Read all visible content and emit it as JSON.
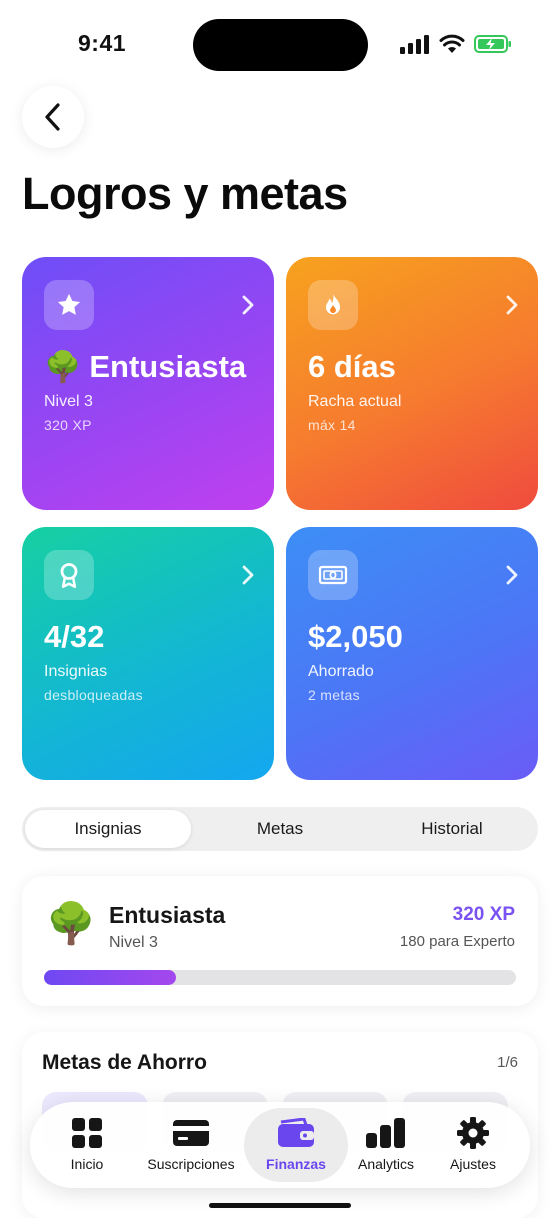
{
  "status_bar": {
    "time": "9:41"
  },
  "header": {
    "title": "Logros y metas"
  },
  "cards": [
    {
      "value": "Entusiasta",
      "emoji": "🌳",
      "label": "Nivel 3",
      "sub": "320 XP",
      "icon": "star-icon"
    },
    {
      "value": "6 días",
      "label": "Racha actual",
      "sub": "máx 14",
      "icon": "flame-icon"
    },
    {
      "value": "4/32",
      "label": "Insignias",
      "sub": "desbloqueadas",
      "icon": "badge-icon"
    },
    {
      "value": "$2,050",
      "label": "Ahorrado",
      "sub": "2 metas",
      "icon": "banknote-icon"
    }
  ],
  "tabs": [
    {
      "label": "Insignias",
      "active": true
    },
    {
      "label": "Metas",
      "active": false
    },
    {
      "label": "Historial",
      "active": false
    }
  ],
  "level": {
    "emoji": "🌳",
    "name": "Entusiasta",
    "level": "Nivel 3",
    "xp": "320 XP",
    "next": "180 para Experto",
    "progress_fraction": 0.28
  },
  "savings": {
    "title": "Metas de Ahorro",
    "count": "1/6"
  },
  "nav": [
    {
      "label": "Inicio",
      "icon": "grid-icon",
      "active": false
    },
    {
      "label": "Suscripciones",
      "icon": "credit-card-icon",
      "active": false
    },
    {
      "label": "Finanzas",
      "icon": "wallet-icon",
      "active": true
    },
    {
      "label": "Analytics",
      "icon": "bar-chart-icon",
      "active": false
    },
    {
      "label": "Ajustes",
      "icon": "gear-icon",
      "active": false
    }
  ],
  "colors": {
    "accent": "#7a52f2",
    "purple_card": "#8a48f4",
    "orange_card": "#f67a2f",
    "teal_card": "#13b7d2",
    "blue_card": "#4c76f6"
  }
}
